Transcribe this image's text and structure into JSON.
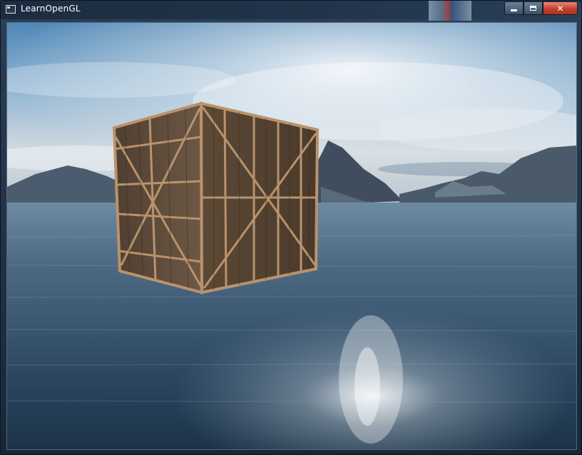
{
  "window": {
    "title": "LearnOpenGL",
    "icon": "window-app-icon",
    "controls": {
      "minimize_icon": "minimize-icon",
      "maximize_icon": "maximize-icon",
      "close_glyph": "✕"
    }
  },
  "scene": {
    "description_tags": [
      "skybox",
      "wooden-crate"
    ],
    "colors": {
      "sky_top": "#4f87b7",
      "sky_horizon": "#d4dbe0",
      "water_near": "#1c3347",
      "water_far": "#5b7a93",
      "mountain": "#46566a",
      "crate_wood": "#6b5440",
      "crate_frame": "#b9936c"
    }
  }
}
